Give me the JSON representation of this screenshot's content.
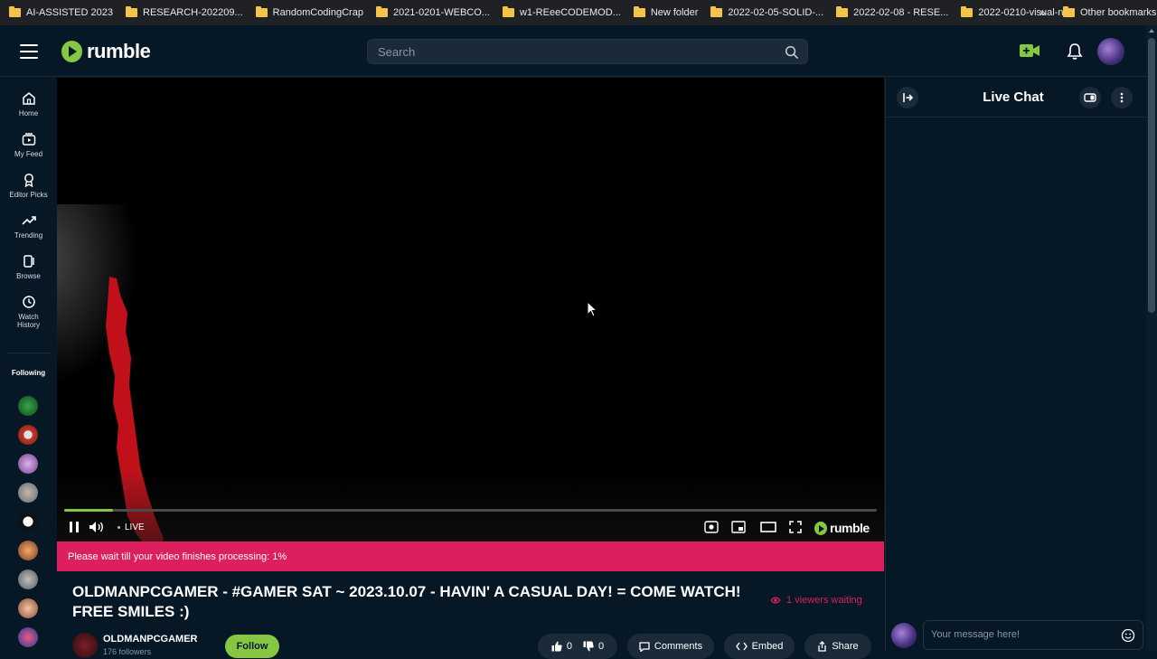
{
  "bookmarks": {
    "items": [
      {
        "label": "AI-ASSISTED 2023",
        "icon": "folder-icon"
      },
      {
        "label": "RESEARCH-202209...",
        "icon": "folder-icon"
      },
      {
        "label": "RandomCodingCrap",
        "icon": "folder-icon"
      },
      {
        "label": "2021-0201-WEBCO...",
        "icon": "folder-icon"
      },
      {
        "label": "w1-REeeCODEMOD...",
        "icon": "folder-icon"
      },
      {
        "label": "New folder",
        "icon": "folder-icon"
      },
      {
        "label": "2022-02-05-SOLID-...",
        "icon": "folder-icon"
      },
      {
        "label": "2022-02-08 - RESE...",
        "icon": "folder-icon"
      },
      {
        "label": "2022-0210-visual-n...",
        "icon": "folder-icon"
      }
    ],
    "more": "»",
    "other": "Other bookmarks"
  },
  "header": {
    "logo_text": "rumble",
    "search_placeholder": "Search"
  },
  "sidebar": {
    "items": [
      {
        "label": "Home",
        "icon": "home-icon"
      },
      {
        "label": "My Feed",
        "icon": "feed-icon"
      },
      {
        "label": "Editor Picks",
        "icon": "ribbon-icon"
      },
      {
        "label": "Trending",
        "icon": "trending-icon"
      },
      {
        "label": "Browse",
        "icon": "browse-icon"
      },
      {
        "label": "Watch",
        "label2": "History",
        "icon": "history-icon"
      }
    ],
    "following_label": "Following"
  },
  "player": {
    "live_label": "LIVE",
    "logo_text": "rumble",
    "progress": 0.06
  },
  "banner": {
    "text": "Please wait till your video finishes processing: 1%"
  },
  "video_info": {
    "title": "OLDMANPCGAMER - #GAMER SAT ~ 2023.10.07 - HAVIN' A CASUAL DAY! = COME WATCH! FREE SMILES :)",
    "viewers": "1 viewers waiting",
    "channel_name": "OLDMANPCGAMER",
    "channel_sub": "176 followers",
    "follow_label": "Follow",
    "likes": "0",
    "dislikes": "0",
    "comments_label": "Comments",
    "embed_label": "Embed",
    "share_label": "Share"
  },
  "chat": {
    "title": "Live Chat",
    "input_placeholder": "Your message here!"
  },
  "colors": {
    "accent": "#85c742",
    "banner": "#de1f5e",
    "background": "#061726"
  }
}
